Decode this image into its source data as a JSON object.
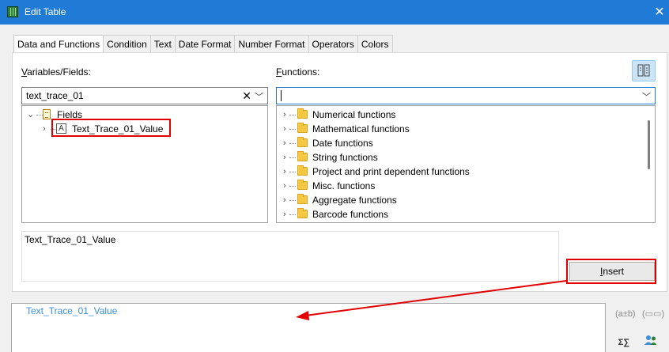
{
  "window": {
    "title": "Edit Table"
  },
  "icons": {
    "app": "spreadsheet-icon",
    "close": "close-icon",
    "folder": "folder-icon"
  },
  "tabs": [
    {
      "label": "Data and Functions",
      "active": true
    },
    {
      "label": "Condition"
    },
    {
      "label": "Text"
    },
    {
      "label": "Date Format"
    },
    {
      "label": "Number Format"
    },
    {
      "label": "Operators"
    },
    {
      "label": "Colors"
    }
  ],
  "variables": {
    "label_accel": "V",
    "label_rest": "ariables/Fields:",
    "filter_value": "text_trace_01",
    "tree": {
      "root": "Fields",
      "child": "Text_Trace_01_Value"
    }
  },
  "functions": {
    "label_accel": "F",
    "label_rest": "unctions:",
    "filter_value": "",
    "items": [
      "Numerical functions",
      "Mathematical functions",
      "Date functions",
      "String functions",
      "Project and print dependent functions",
      "Misc. functions",
      "Aggregate functions",
      "Barcode functions"
    ]
  },
  "description": "Text_Trace_01_Value",
  "insert": {
    "accel": "I",
    "rest": "nsert"
  },
  "formula": {
    "text": "Text_Trace_01_Value"
  },
  "side_icons": [
    "(a±b)",
    "(▭▭)",
    "Σ∑",
    "users-icon"
  ],
  "colors": {
    "accent": "#1f7bd6",
    "highlight": "#e00000",
    "formula_text": "#3b8ed8"
  }
}
